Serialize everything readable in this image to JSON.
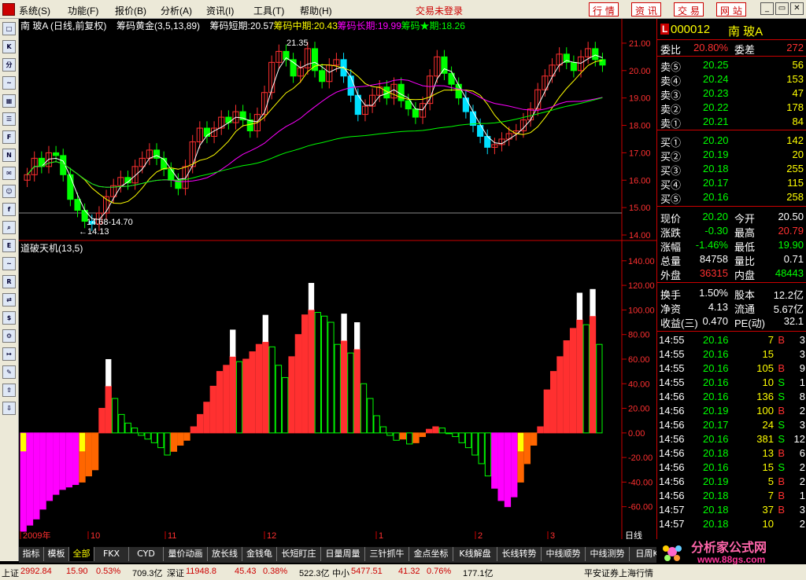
{
  "menu": {
    "items": [
      "系统(S)",
      "功能(F)",
      "报价(B)",
      "分析(A)",
      "资讯(I)",
      "工具(T)",
      "帮助(H)"
    ],
    "trade_status": "交易未登录",
    "quick_buttons": [
      "行 情",
      "资 讯",
      "交 易",
      "网 站"
    ]
  },
  "toolbar": {
    "icons": [
      "full-screen-icon",
      "kline-icon",
      "minute-chart-icon",
      "trend-icon",
      "multi-window-icon",
      "list-icon",
      "f10-icon",
      "news-icon",
      "mail-icon",
      "users-icon",
      "f10-doc-icon",
      "search-icon",
      "etf-icon",
      "macd-icon",
      "rsi-icon",
      "switch-icon",
      "dollar-icon",
      "tools-icon",
      "export-icon",
      "pen-icon",
      "up-arrow-icon",
      "down-arrow-icon"
    ],
    "labels": [
      "□",
      "K",
      "分",
      "~",
      "▦",
      "☰",
      "F",
      "N",
      "✉",
      "☺",
      "f",
      "⌕",
      "E",
      "~",
      "R",
      "⇄",
      "$",
      "⚙",
      "↦",
      "✎",
      "⇧",
      "⇩"
    ]
  },
  "chart_header": {
    "stock": "南 玻A (日线,前复权)",
    "indicators": [
      {
        "label": "筹码黄金(3,5,13,89)",
        "color": "#ffffff"
      },
      {
        "label": "筹码短期:20.57",
        "color": "#ffffff"
      },
      {
        "label": "筹码中期:20.43",
        "color": "#ffff00"
      },
      {
        "label": "筹码长期:19.99",
        "color": "#ff00ff"
      },
      {
        "label": "筹码★期:18.26",
        "color": "#00ff00"
      }
    ]
  },
  "price_axis": [
    "21.00",
    "20.00",
    "19.00",
    "18.00",
    "17.00",
    "16.00",
    "15.00",
    "14.00"
  ],
  "price_annotations": {
    "high": "21.35",
    "range": "14.68-14.70",
    "low": "←14.13"
  },
  "sub_header": "道破天机(13,5)",
  "sub_axis": [
    "140.00",
    "120.00",
    "100.00",
    "80.00",
    "60.00",
    "40.00",
    "20.00",
    "0.00",
    "-20.00",
    "-40.00",
    "-60.00"
  ],
  "time_axis": [
    "2009年",
    "10",
    "11",
    "12",
    "1",
    "2",
    "3"
  ],
  "time_axis_label": "日线",
  "quote": {
    "code": "000012",
    "name": "南 玻A",
    "l_mark": "L",
    "weibi_label": "委比",
    "weibi": "20.80%",
    "weicha_label": "委差",
    "weicha": "272",
    "sell": [
      {
        "label": "卖⑤",
        "price": "20.25",
        "vol": "56"
      },
      {
        "label": "卖④",
        "price": "20.24",
        "vol": "153"
      },
      {
        "label": "卖③",
        "price": "20.23",
        "vol": "47"
      },
      {
        "label": "卖②",
        "price": "20.22",
        "vol": "178"
      },
      {
        "label": "卖①",
        "price": "20.21",
        "vol": "84"
      }
    ],
    "buy": [
      {
        "label": "买①",
        "price": "20.20",
        "vol": "142"
      },
      {
        "label": "买②",
        "price": "20.19",
        "vol": "20"
      },
      {
        "label": "买③",
        "price": "20.18",
        "vol": "255"
      },
      {
        "label": "买④",
        "price": "20.17",
        "vol": "115"
      },
      {
        "label": "买⑤",
        "price": "20.16",
        "vol": "258"
      }
    ],
    "stats": [
      {
        "l1": "现价",
        "v1": "20.20",
        "c1": "#00ff00",
        "l2": "今开",
        "v2": "20.50",
        "c2": "#ffffff"
      },
      {
        "l1": "涨跌",
        "v1": "-0.30",
        "c1": "#00ff00",
        "l2": "最高",
        "v2": "20.79",
        "c2": "#ff3030"
      },
      {
        "l1": "涨幅",
        "v1": "-1.46%",
        "c1": "#00ff00",
        "l2": "最低",
        "v2": "19.90",
        "c2": "#00ff00"
      },
      {
        "l1": "总量",
        "v1": "84758",
        "c1": "#ffffff",
        "l2": "量比",
        "v2": "0.71",
        "c2": "#ffffff"
      },
      {
        "l1": "外盘",
        "v1": "36315",
        "c1": "#ff3030",
        "l2": "内盘",
        "v2": "48443",
        "c2": "#00ff00"
      }
    ],
    "stats2": [
      {
        "l1": "换手",
        "v1": "1.50%",
        "l2": "股本",
        "v2": "12.2亿"
      },
      {
        "l1": "净资",
        "v1": "4.13",
        "l2": "流通",
        "v2": "5.67亿"
      },
      {
        "l1": "收益(三)",
        "v1": "0.470",
        "l2": "PE(动)",
        "v2": "32.1"
      }
    ],
    "ticks": [
      {
        "t": "14:55",
        "p": "20.16",
        "v": "7",
        "bs": "B",
        "n": "3"
      },
      {
        "t": "14:55",
        "p": "20.16",
        "v": "15",
        "bs": "",
        "n": "3"
      },
      {
        "t": "14:55",
        "p": "20.16",
        "v": "105",
        "bs": "B",
        "n": "9"
      },
      {
        "t": "14:55",
        "p": "20.16",
        "v": "10",
        "bs": "S",
        "n": "1"
      },
      {
        "t": "14:56",
        "p": "20.16",
        "v": "136",
        "bs": "S",
        "n": "8"
      },
      {
        "t": "14:56",
        "p": "20.19",
        "v": "100",
        "bs": "B",
        "n": "2"
      },
      {
        "t": "14:56",
        "p": "20.17",
        "v": "24",
        "bs": "S",
        "n": "3"
      },
      {
        "t": "14:56",
        "p": "20.16",
        "v": "381",
        "bs": "S",
        "n": "12"
      },
      {
        "t": "14:56",
        "p": "20.18",
        "v": "13",
        "bs": "B",
        "n": "6"
      },
      {
        "t": "14:56",
        "p": "20.16",
        "v": "15",
        "bs": "S",
        "n": "2"
      },
      {
        "t": "14:56",
        "p": "20.19",
        "v": "5",
        "bs": "B",
        "n": "2"
      },
      {
        "t": "14:56",
        "p": "20.18",
        "v": "7",
        "bs": "B",
        "n": "1"
      },
      {
        "t": "14:57",
        "p": "20.18",
        "v": "37",
        "bs": "B",
        "n": "3"
      },
      {
        "t": "14:57",
        "p": "20.18",
        "v": "10",
        "bs": "",
        "n": "2"
      }
    ]
  },
  "bottom_tabs": [
    "指标",
    "模板",
    "全部",
    "FKX",
    "CYD",
    "量价动画",
    "放长线",
    "金钱龟",
    "长短盯庄",
    "日量周量",
    "三针抓牛",
    "金点坐标",
    "K线解盘",
    "长线转势",
    "中线顺势",
    "中线测势",
    "日周K线"
  ],
  "watermark": {
    "title": "分析家公式网",
    "url": "www.88gs.com"
  },
  "status": {
    "sh_label": "上证",
    "sh_value": "2992.84",
    "sh_change": "15.90",
    "sh_pct": "0.53%",
    "sh_amount": "709.3亿",
    "sz_label": "深证",
    "sz_value": "11948.8",
    "sz_change": "45.43",
    "sz_pct": "0.38%",
    "sz_amount": "522.3亿",
    "zx_label": "中小",
    "zx_value": "5477.51",
    "zx_change": "41.32",
    "zx_pct": "0.76%",
    "zx_amount": "177.1亿",
    "broker": "平安证券上海行情"
  },
  "colors": {
    "up": "#ff3030",
    "down": "#00ff00",
    "cyan": "#00e0ff",
    "magenta": "#ff00ff",
    "yellow": "#ffff00",
    "orange": "#ff6600"
  },
  "chart_data": [
    {
      "type": "candlestick",
      "title": "南 玻A (日线,前复权)",
      "ylim": [
        13.8,
        21.6
      ],
      "x_categories": [
        "2009年",
        "10",
        "11",
        "12",
        "1",
        "2",
        "3"
      ],
      "annotations": [
        "21.35",
        "14.68-14.70",
        "14.13"
      ],
      "series": [
        {
          "name": "筹码短期",
          "last": 20.57
        },
        {
          "name": "筹码中期",
          "last": 20.43
        },
        {
          "name": "筹码长期",
          "last": 19.99
        },
        {
          "name": "筹码★期",
          "last": 18.26
        }
      ],
      "close_approx": [
        16.2,
        16.8,
        16.5,
        17.0,
        16.9,
        16.2,
        15.3,
        14.9,
        14.5,
        14.4,
        14.8,
        15.4,
        15.8,
        16.1,
        15.9,
        16.5,
        16.8,
        17.1,
        16.8,
        16.4,
        16.0,
        15.7,
        16.5,
        17.4,
        17.9,
        17.6,
        17.9,
        18.3,
        18.1,
        18.5,
        18.2,
        17.8,
        18.4,
        19.2,
        20.3,
        20.7,
        20.4,
        19.8,
        20.1,
        20.8,
        20.0,
        19.6,
        20.2,
        20.4,
        19.8,
        19.1,
        18.4,
        18.7,
        19.1,
        19.4,
        19.0,
        19.5,
        18.9,
        18.6,
        18.3,
        18.8,
        19.8,
        20.5,
        19.9,
        19.5,
        19.0,
        18.5,
        18.0,
        17.6,
        17.2,
        17.3,
        17.5,
        17.7,
        17.8,
        18.2,
        18.6,
        19.3,
        19.8,
        20.2,
        20.6,
        20.3,
        20.0,
        20.5,
        20.8,
        20.4,
        20.2
      ]
    },
    {
      "type": "bar",
      "title": "道破天机(13,5)",
      "ylim": [
        -80,
        145
      ],
      "values": [
        -80,
        -75,
        -70,
        -62,
        -55,
        -50,
        -46,
        -44,
        -42,
        -40,
        -35,
        -30,
        20,
        38,
        28,
        15,
        8,
        4,
        -2,
        -5,
        -8,
        -12,
        -18,
        -15,
        -10,
        -6,
        5,
        15,
        25,
        38,
        50,
        55,
        62,
        58,
        60,
        66,
        72,
        74,
        70,
        55,
        45,
        62,
        80,
        96,
        100,
        98,
        95,
        90,
        72,
        75,
        65,
        68,
        40,
        28,
        14,
        5,
        -2,
        -6,
        -5,
        -9,
        -8,
        -3,
        3,
        5,
        4,
        0,
        -3,
        -8,
        -12,
        -18,
        -25,
        -35,
        -45,
        -55,
        -60,
        -52,
        -40,
        -25,
        -10,
        5,
        35,
        50,
        62,
        75,
        85,
        92,
        88,
        95,
        72
      ]
    }
  ]
}
